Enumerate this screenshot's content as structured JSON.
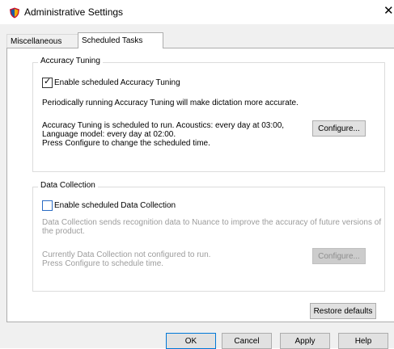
{
  "window": {
    "title": "Administrative Settings",
    "close_glyph": "✕"
  },
  "tabs": [
    {
      "label": "Miscellaneous"
    },
    {
      "label": "Scheduled Tasks"
    }
  ],
  "accuracy": {
    "group_title": "Accuracy Tuning",
    "checkbox_label": "Enable scheduled Accuracy Tuning",
    "checkbox_checked": true,
    "description": "Periodically running Accuracy Tuning will make dictation more accurate.",
    "schedule_line1": "Accuracy Tuning is scheduled to run. Acoustics: every day at 03:00,",
    "schedule_line2": "Language model: every day at 02:00.",
    "schedule_line3": "Press Configure to change the scheduled time.",
    "configure_label": "Configure..."
  },
  "data_collection": {
    "group_title": "Data Collection",
    "checkbox_label": "Enable scheduled Data Collection",
    "checkbox_checked": false,
    "description_line1": "Data Collection sends recognition data to Nuance to improve the accuracy of future versions of",
    "description_line2": "the product.",
    "status_line1": "Currently Data Collection not configured to run.",
    "status_line2": "Press Configure to schedule time.",
    "configure_label": "Configure..."
  },
  "restore_label": "Restore defaults",
  "footer": {
    "ok_label": "OK",
    "cancel_label": "Cancel",
    "apply_label": "Apply",
    "help_label": "Help"
  }
}
